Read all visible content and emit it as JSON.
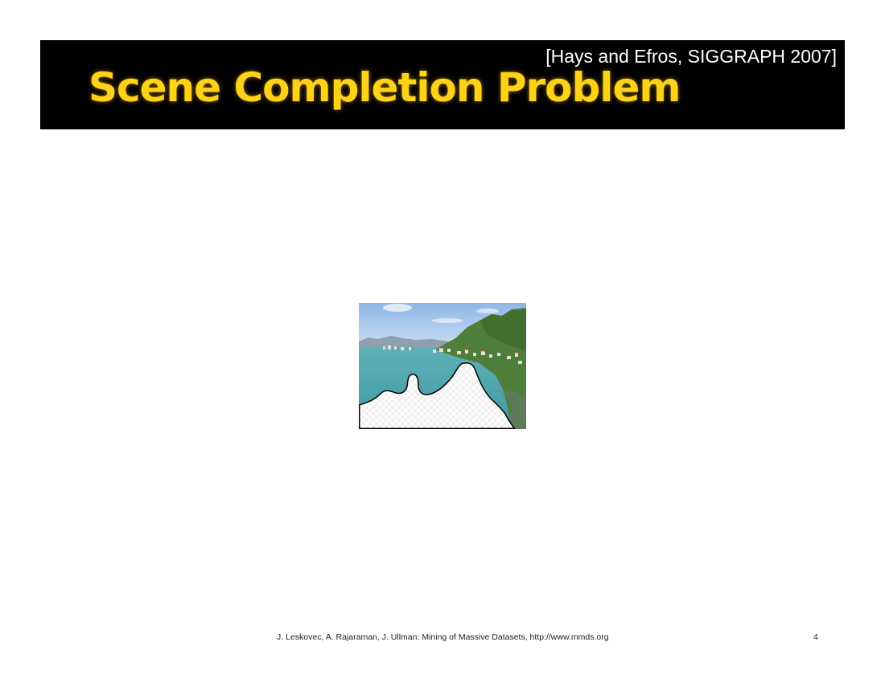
{
  "slide": {
    "citation": "[Hays and Efros, SIGGRAPH 2007]",
    "title": "Scene Completion Problem",
    "title_color": "#ffd21a",
    "title_bar_color": "#000000"
  },
  "footer": {
    "text": "J. Leskovec, A. Rajaraman, J. Ullman: Mining of Massive Datasets, http://www.mmds.org",
    "page_number": "4"
  }
}
